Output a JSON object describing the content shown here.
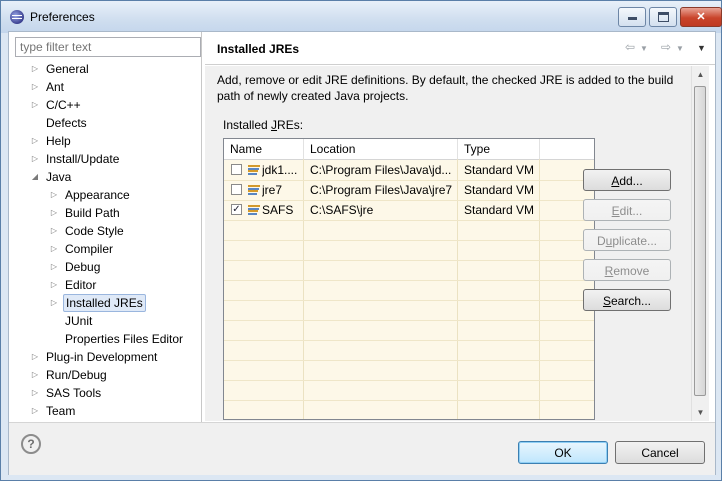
{
  "window": {
    "title": "Preferences"
  },
  "filter": {
    "placeholder": "type filter text"
  },
  "tree": [
    {
      "label": "General",
      "level": 0,
      "arrow": "collapsed"
    },
    {
      "label": "Ant",
      "level": 0,
      "arrow": "collapsed"
    },
    {
      "label": "C/C++",
      "level": 0,
      "arrow": "collapsed"
    },
    {
      "label": "Defects",
      "level": 0,
      "arrow": "none"
    },
    {
      "label": "Help",
      "level": 0,
      "arrow": "collapsed"
    },
    {
      "label": "Install/Update",
      "level": 0,
      "arrow": "collapsed"
    },
    {
      "label": "Java",
      "level": 0,
      "arrow": "expanded"
    },
    {
      "label": "Appearance",
      "level": 1,
      "arrow": "collapsed"
    },
    {
      "label": "Build Path",
      "level": 1,
      "arrow": "collapsed"
    },
    {
      "label": "Code Style",
      "level": 1,
      "arrow": "collapsed"
    },
    {
      "label": "Compiler",
      "level": 1,
      "arrow": "collapsed"
    },
    {
      "label": "Debug",
      "level": 1,
      "arrow": "collapsed"
    },
    {
      "label": "Editor",
      "level": 1,
      "arrow": "collapsed"
    },
    {
      "label": "Installed JREs",
      "level": 1,
      "arrow": "collapsed",
      "selected": true
    },
    {
      "label": "JUnit",
      "level": 1,
      "arrow": "none"
    },
    {
      "label": "Properties Files Editor",
      "level": 1,
      "arrow": "none"
    },
    {
      "label": "Plug-in Development",
      "level": 0,
      "arrow": "collapsed"
    },
    {
      "label": "Run/Debug",
      "level": 0,
      "arrow": "collapsed"
    },
    {
      "label": "SAS Tools",
      "level": 0,
      "arrow": "collapsed"
    },
    {
      "label": "Team",
      "level": 0,
      "arrow": "collapsed"
    }
  ],
  "page": {
    "title": "Installed JREs",
    "description": "Add, remove or edit JRE definitions. By default, the checked JRE is added to the build path of newly created Java projects.",
    "installed_label": "Installed JREs:"
  },
  "table": {
    "columns": [
      "Name",
      "Location",
      "Type"
    ],
    "rows": [
      {
        "checked": false,
        "name": "jdk1....",
        "location": "C:\\Program Files\\Java\\jd...",
        "type": "Standard VM"
      },
      {
        "checked": false,
        "name": "jre7",
        "location": "C:\\Program Files\\Java\\jre7",
        "type": "Standard VM"
      },
      {
        "checked": true,
        "name": "SAFS",
        "location": "C:\\SAFS\\jre",
        "type": "Standard VM"
      }
    ]
  },
  "buttons": {
    "add": "Add...",
    "edit": "Edit...",
    "duplicate": "Duplicate...",
    "remove": "Remove",
    "search": "Search...",
    "ok": "OK",
    "cancel": "Cancel"
  },
  "colors": {
    "table_bg": "#fdf8e8",
    "selection": "#dfe9f7",
    "ok_border": "#3c7fb1"
  }
}
